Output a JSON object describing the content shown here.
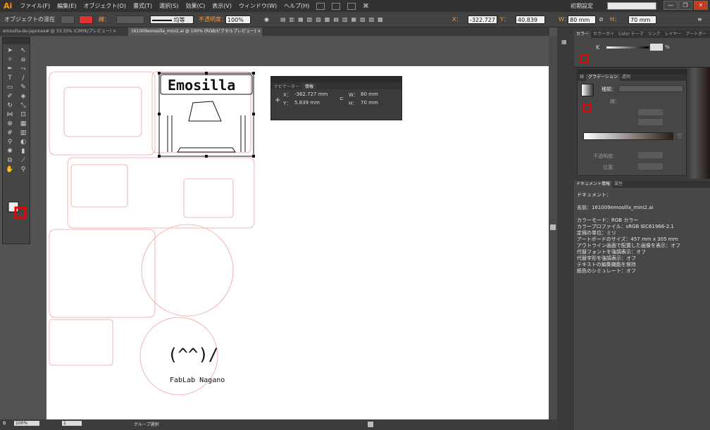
{
  "menubar": {
    "logo": "Ai",
    "items": [
      "ファイル(F)",
      "編集(E)",
      "オブジェクト(O)",
      "書式(T)",
      "選択(S)",
      "効果(C)",
      "表示(V)",
      "ウィンドウ(W)",
      "ヘルプ(H)"
    ],
    "workspace": "初期設定",
    "window_buttons": [
      "—",
      "❐",
      "✕"
    ]
  },
  "control_bar": {
    "selection_label": "オブジェクトの混在",
    "stroke_label": "線：",
    "stroke_style": "均等",
    "opacity_label": "不透明度：",
    "opacity_value": "100%",
    "x_label": "X：",
    "x_value": "-322.727 m",
    "y_label": "Y：",
    "y_value": "40.839 mi",
    "w_label": "W：",
    "w_value": "80 mm",
    "h_label": "H：",
    "h_value": "70 mm"
  },
  "document_tabs": [
    {
      "label": "emosilla-de-japonea# @ 33.33% (CMYK/プレビュー)",
      "close": "×",
      "active": false
    },
    {
      "label": "161009emosilla_mini2.ai @ 100% (RGB/ピクセルプレビュー)",
      "close": "×",
      "active": true
    }
  ],
  "info_panel": {
    "tabs": [
      "ナビゲーター",
      "情報"
    ],
    "x_label": "X：",
    "x_value": "-362.727 mm",
    "y_label": "Y：",
    "y_value": "5.839 mm",
    "w_label": "W：",
    "w_value": "80 mm",
    "h_label": "H：",
    "h_value": "70 mm"
  },
  "artwork": {
    "logo_text": "Emosilla",
    "face_text": "(^^)/",
    "fablab_text": "FabLab Nagano"
  },
  "color_panel": {
    "tabs": [
      "カラー",
      "カラーガイ",
      "Color テーマ",
      "リンク",
      "レイヤー",
      "アートボー"
    ],
    "k_label": "K",
    "k_unit": "%"
  },
  "gradient_panel": {
    "tabs": [
      "線",
      "グラデーション",
      "透明"
    ],
    "type_label": "種類：",
    "stroke_label": "線：",
    "opacity_label": "不透明度：",
    "position_label": "位置："
  },
  "doc_info": {
    "tabs": [
      "ドキュメント情報",
      "属性"
    ],
    "header": "ドキュメント：",
    "name": "名前：161009emosilla_mini2.ai",
    "lines": [
      "カラーモード：RGB カラー",
      "カラープロファイル：sRGB IEC61966-2.1",
      "定規の単位：ミリ",
      "アートボードのサイズ：457 mm x 305 mm",
      "アウトライン画面で配置した画像を表示：オフ",
      "代替フォントを強調表示：オフ",
      "代替字形を強調表示：オフ",
      "テキストの編集機能を保持",
      "紙色のシミュレート：オフ"
    ]
  },
  "status_bar": {
    "zoom": "100%",
    "page": "1",
    "mode": "グループ選択"
  },
  "colors": {
    "accent": "#ff9a00",
    "close_red": "#c43b1d",
    "cut_line": "#f0a0a0"
  }
}
